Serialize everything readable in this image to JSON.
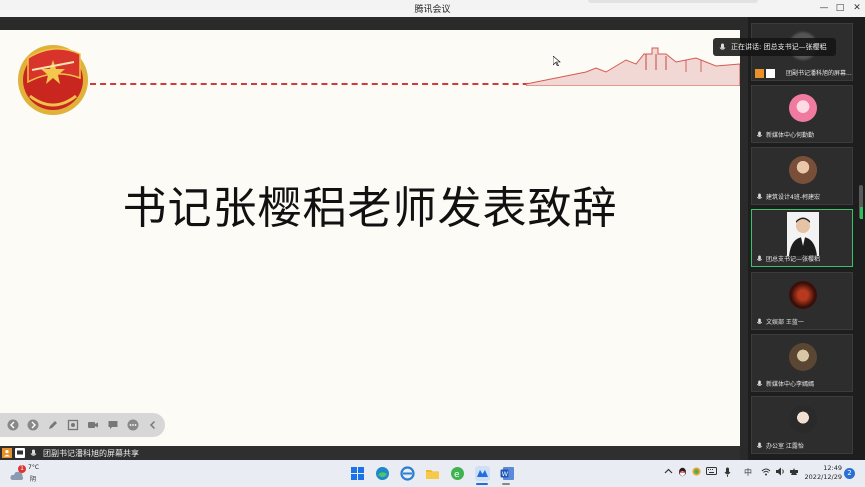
{
  "window": {
    "title": "腾讯会议",
    "controls": {
      "minimize": "—",
      "maximize": "□",
      "close": "✕"
    }
  },
  "slide": {
    "title": "书记张樱稆老师发表致辞",
    "emblem_icon": "youth-league-emblem-icon",
    "accent_color": "#d23b3b"
  },
  "toolbar": {
    "tools": [
      "prev-icon",
      "next-icon",
      "pen-icon",
      "screenshot-icon",
      "camera-icon",
      "chat-icon",
      "more-icon",
      "collapse-icon"
    ]
  },
  "share_bar": {
    "label": "团副书记潘科旭的屏幕共享"
  },
  "speaking": {
    "label": "正在讲话: 团总支书记—张樱稆"
  },
  "participants": [
    {
      "name": "团副书记潘科旭的屏幕...",
      "avatar": "blurred",
      "active": false
    },
    {
      "name": "新媒体中心何勤勤",
      "avatar": "pink",
      "active": false
    },
    {
      "name": "建筑设计4班-柯建宏",
      "avatar": "brown",
      "active": false
    },
    {
      "name": "团总支书记—张樱稆",
      "avatar": "man",
      "active": true
    },
    {
      "name": "文娱部 王蓝一",
      "avatar": "dark-red",
      "active": false
    },
    {
      "name": "新媒体中心李嫣嫣",
      "avatar": "sepia",
      "active": false
    },
    {
      "name": "办公室 江露怡",
      "avatar": "girl",
      "active": false
    }
  ],
  "taskbar": {
    "weather_temp": "7°C",
    "weather_desc": "阴",
    "weather_badge": "1",
    "ime": "中",
    "time": "12:49",
    "date": "2022/12/29",
    "notifications": "2"
  }
}
